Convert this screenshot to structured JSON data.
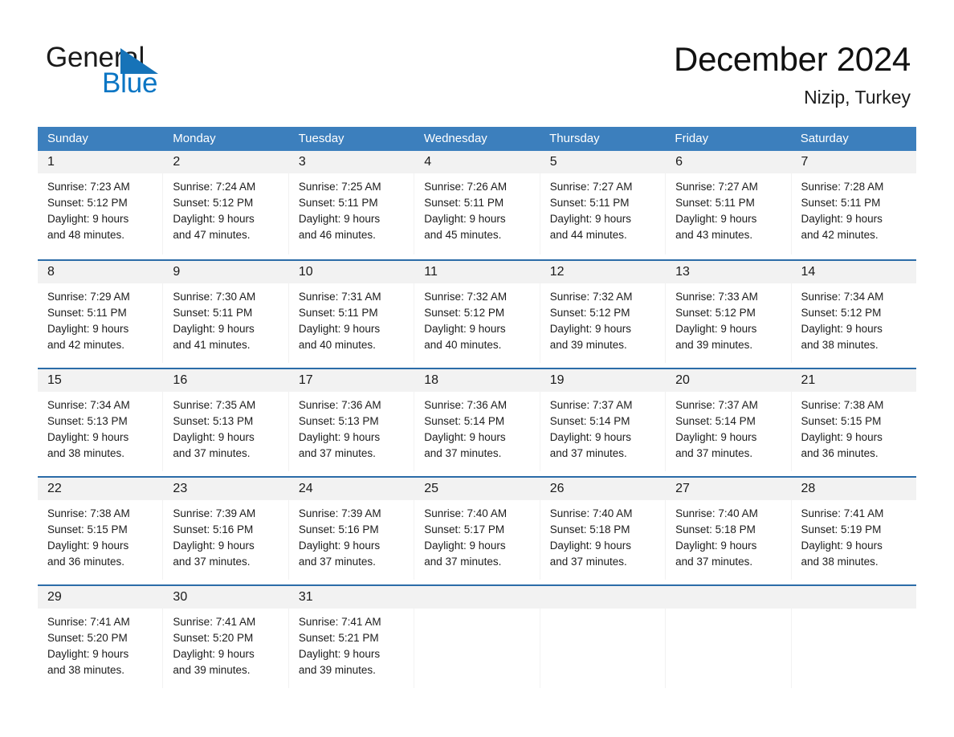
{
  "brand": {
    "name_top": "General",
    "name_bottom": "Blue",
    "accent_color": "#0b76c4",
    "triangle_color": "#1673b8"
  },
  "header": {
    "month_title": "December 2024",
    "location": "Nizip, Turkey"
  },
  "theme": {
    "header_bg": "#3c7fbd",
    "week_border": "#2b6ca8",
    "day_band_bg": "#f2f2f2"
  },
  "day_headers": [
    "Sunday",
    "Monday",
    "Tuesday",
    "Wednesday",
    "Thursday",
    "Friday",
    "Saturday"
  ],
  "weeks": [
    [
      {
        "day": "1",
        "sunrise": "Sunrise: 7:23 AM",
        "sunset": "Sunset: 5:12 PM",
        "daylight1": "Daylight: 9 hours",
        "daylight2": "and 48 minutes."
      },
      {
        "day": "2",
        "sunrise": "Sunrise: 7:24 AM",
        "sunset": "Sunset: 5:12 PM",
        "daylight1": "Daylight: 9 hours",
        "daylight2": "and 47 minutes."
      },
      {
        "day": "3",
        "sunrise": "Sunrise: 7:25 AM",
        "sunset": "Sunset: 5:11 PM",
        "daylight1": "Daylight: 9 hours",
        "daylight2": "and 46 minutes."
      },
      {
        "day": "4",
        "sunrise": "Sunrise: 7:26 AM",
        "sunset": "Sunset: 5:11 PM",
        "daylight1": "Daylight: 9 hours",
        "daylight2": "and 45 minutes."
      },
      {
        "day": "5",
        "sunrise": "Sunrise: 7:27 AM",
        "sunset": "Sunset: 5:11 PM",
        "daylight1": "Daylight: 9 hours",
        "daylight2": "and 44 minutes."
      },
      {
        "day": "6",
        "sunrise": "Sunrise: 7:27 AM",
        "sunset": "Sunset: 5:11 PM",
        "daylight1": "Daylight: 9 hours",
        "daylight2": "and 43 minutes."
      },
      {
        "day": "7",
        "sunrise": "Sunrise: 7:28 AM",
        "sunset": "Sunset: 5:11 PM",
        "daylight1": "Daylight: 9 hours",
        "daylight2": "and 42 minutes."
      }
    ],
    [
      {
        "day": "8",
        "sunrise": "Sunrise: 7:29 AM",
        "sunset": "Sunset: 5:11 PM",
        "daylight1": "Daylight: 9 hours",
        "daylight2": "and 42 minutes."
      },
      {
        "day": "9",
        "sunrise": "Sunrise: 7:30 AM",
        "sunset": "Sunset: 5:11 PM",
        "daylight1": "Daylight: 9 hours",
        "daylight2": "and 41 minutes."
      },
      {
        "day": "10",
        "sunrise": "Sunrise: 7:31 AM",
        "sunset": "Sunset: 5:11 PM",
        "daylight1": "Daylight: 9 hours",
        "daylight2": "and 40 minutes."
      },
      {
        "day": "11",
        "sunrise": "Sunrise: 7:32 AM",
        "sunset": "Sunset: 5:12 PM",
        "daylight1": "Daylight: 9 hours",
        "daylight2": "and 40 minutes."
      },
      {
        "day": "12",
        "sunrise": "Sunrise: 7:32 AM",
        "sunset": "Sunset: 5:12 PM",
        "daylight1": "Daylight: 9 hours",
        "daylight2": "and 39 minutes."
      },
      {
        "day": "13",
        "sunrise": "Sunrise: 7:33 AM",
        "sunset": "Sunset: 5:12 PM",
        "daylight1": "Daylight: 9 hours",
        "daylight2": "and 39 minutes."
      },
      {
        "day": "14",
        "sunrise": "Sunrise: 7:34 AM",
        "sunset": "Sunset: 5:12 PM",
        "daylight1": "Daylight: 9 hours",
        "daylight2": "and 38 minutes."
      }
    ],
    [
      {
        "day": "15",
        "sunrise": "Sunrise: 7:34 AM",
        "sunset": "Sunset: 5:13 PM",
        "daylight1": "Daylight: 9 hours",
        "daylight2": "and 38 minutes."
      },
      {
        "day": "16",
        "sunrise": "Sunrise: 7:35 AM",
        "sunset": "Sunset: 5:13 PM",
        "daylight1": "Daylight: 9 hours",
        "daylight2": "and 37 minutes."
      },
      {
        "day": "17",
        "sunrise": "Sunrise: 7:36 AM",
        "sunset": "Sunset: 5:13 PM",
        "daylight1": "Daylight: 9 hours",
        "daylight2": "and 37 minutes."
      },
      {
        "day": "18",
        "sunrise": "Sunrise: 7:36 AM",
        "sunset": "Sunset: 5:14 PM",
        "daylight1": "Daylight: 9 hours",
        "daylight2": "and 37 minutes."
      },
      {
        "day": "19",
        "sunrise": "Sunrise: 7:37 AM",
        "sunset": "Sunset: 5:14 PM",
        "daylight1": "Daylight: 9 hours",
        "daylight2": "and 37 minutes."
      },
      {
        "day": "20",
        "sunrise": "Sunrise: 7:37 AM",
        "sunset": "Sunset: 5:14 PM",
        "daylight1": "Daylight: 9 hours",
        "daylight2": "and 37 minutes."
      },
      {
        "day": "21",
        "sunrise": "Sunrise: 7:38 AM",
        "sunset": "Sunset: 5:15 PM",
        "daylight1": "Daylight: 9 hours",
        "daylight2": "and 36 minutes."
      }
    ],
    [
      {
        "day": "22",
        "sunrise": "Sunrise: 7:38 AM",
        "sunset": "Sunset: 5:15 PM",
        "daylight1": "Daylight: 9 hours",
        "daylight2": "and 36 minutes."
      },
      {
        "day": "23",
        "sunrise": "Sunrise: 7:39 AM",
        "sunset": "Sunset: 5:16 PM",
        "daylight1": "Daylight: 9 hours",
        "daylight2": "and 37 minutes."
      },
      {
        "day": "24",
        "sunrise": "Sunrise: 7:39 AM",
        "sunset": "Sunset: 5:16 PM",
        "daylight1": "Daylight: 9 hours",
        "daylight2": "and 37 minutes."
      },
      {
        "day": "25",
        "sunrise": "Sunrise: 7:40 AM",
        "sunset": "Sunset: 5:17 PM",
        "daylight1": "Daylight: 9 hours",
        "daylight2": "and 37 minutes."
      },
      {
        "day": "26",
        "sunrise": "Sunrise: 7:40 AM",
        "sunset": "Sunset: 5:18 PM",
        "daylight1": "Daylight: 9 hours",
        "daylight2": "and 37 minutes."
      },
      {
        "day": "27",
        "sunrise": "Sunrise: 7:40 AM",
        "sunset": "Sunset: 5:18 PM",
        "daylight1": "Daylight: 9 hours",
        "daylight2": "and 37 minutes."
      },
      {
        "day": "28",
        "sunrise": "Sunrise: 7:41 AM",
        "sunset": "Sunset: 5:19 PM",
        "daylight1": "Daylight: 9 hours",
        "daylight2": "and 38 minutes."
      }
    ],
    [
      {
        "day": "29",
        "sunrise": "Sunrise: 7:41 AM",
        "sunset": "Sunset: 5:20 PM",
        "daylight1": "Daylight: 9 hours",
        "daylight2": "and 38 minutes."
      },
      {
        "day": "30",
        "sunrise": "Sunrise: 7:41 AM",
        "sunset": "Sunset: 5:20 PM",
        "daylight1": "Daylight: 9 hours",
        "daylight2": "and 39 minutes."
      },
      {
        "day": "31",
        "sunrise": "Sunrise: 7:41 AM",
        "sunset": "Sunset: 5:21 PM",
        "daylight1": "Daylight: 9 hours",
        "daylight2": "and 39 minutes."
      },
      {
        "day": "",
        "sunrise": "",
        "sunset": "",
        "daylight1": "",
        "daylight2": ""
      },
      {
        "day": "",
        "sunrise": "",
        "sunset": "",
        "daylight1": "",
        "daylight2": ""
      },
      {
        "day": "",
        "sunrise": "",
        "sunset": "",
        "daylight1": "",
        "daylight2": ""
      },
      {
        "day": "",
        "sunrise": "",
        "sunset": "",
        "daylight1": "",
        "daylight2": ""
      }
    ]
  ]
}
